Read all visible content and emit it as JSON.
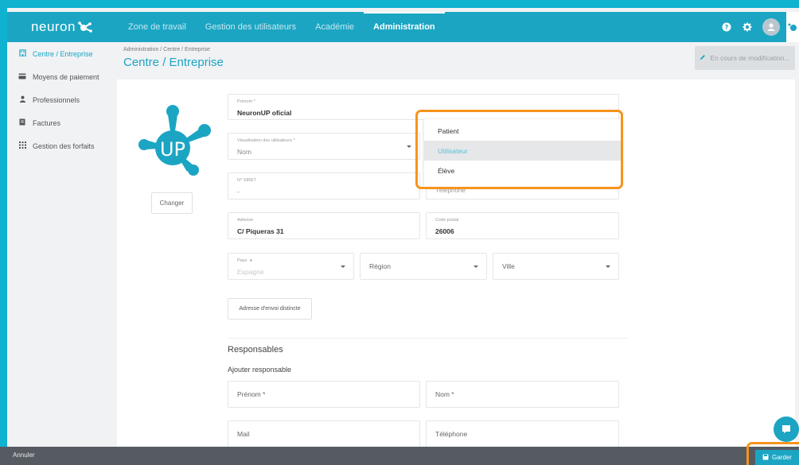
{
  "app": {
    "logo_text": "neuron"
  },
  "nav": {
    "tabs": [
      {
        "label": "Zone de travail"
      },
      {
        "label": "Gestion des utilisateurs"
      },
      {
        "label": "Académie"
      },
      {
        "label": "Administration"
      }
    ],
    "active_tab": "Administration",
    "icons": [
      "help-icon",
      "settings-icon",
      "user-avatar",
      "app-logo-icon"
    ]
  },
  "sidebar": {
    "items": [
      {
        "label": "Centre / Entreprise",
        "icon": "building-icon",
        "active": true
      },
      {
        "label": "Moyens de paiement",
        "icon": "credit-card-icon"
      },
      {
        "label": "Professionnels",
        "icon": "person-icon"
      },
      {
        "label": "Factures",
        "icon": "invoice-icon"
      },
      {
        "label": "Gestion des forfaits",
        "icon": "grid-icon"
      }
    ]
  },
  "header": {
    "breadcrumb": "Administration / Centre / Entreprise",
    "title": "Centre / Entreprise",
    "edit_status": "En cours de modification..."
  },
  "profile": {
    "logo_text": "UP",
    "change_label": "Changer"
  },
  "form": {
    "prenom": {
      "label": "Prénom *",
      "value": "NeuronUP oficial"
    },
    "visualisation": {
      "label": "Visualisation des utilisateurs *",
      "value": "Nom"
    },
    "siret": {
      "label": "N° SIRET",
      "value": "-"
    },
    "telephone_partial": "Téléphone",
    "adresse": {
      "label": "Adresse",
      "value": "C/ Piqueras 31"
    },
    "code_postal": {
      "label": "Code postal",
      "value": "26006"
    },
    "pays": {
      "label": "Pays",
      "value": "Espagne"
    },
    "region": {
      "placeholder": "Région"
    },
    "ville": {
      "placeholder": "Ville"
    },
    "address_button": "Adresse d'envoi distincte"
  },
  "responsables": {
    "title": "Responsables",
    "subtitle": "Ajouter responsable",
    "fields": {
      "prenom": "Prénom *",
      "nom": "Nom *",
      "mail": "Mail",
      "telephone": "Téléphone"
    }
  },
  "dropdown": {
    "options": [
      "Patient",
      "Utilisateur",
      "Élève"
    ],
    "selected": "Utilisateur"
  },
  "footer": {
    "cancel": "Annuler",
    "save": "Garder"
  },
  "colors": {
    "accent": "#1ba5c3",
    "highlight": "#f7941d",
    "background": "#0fb3cf"
  }
}
